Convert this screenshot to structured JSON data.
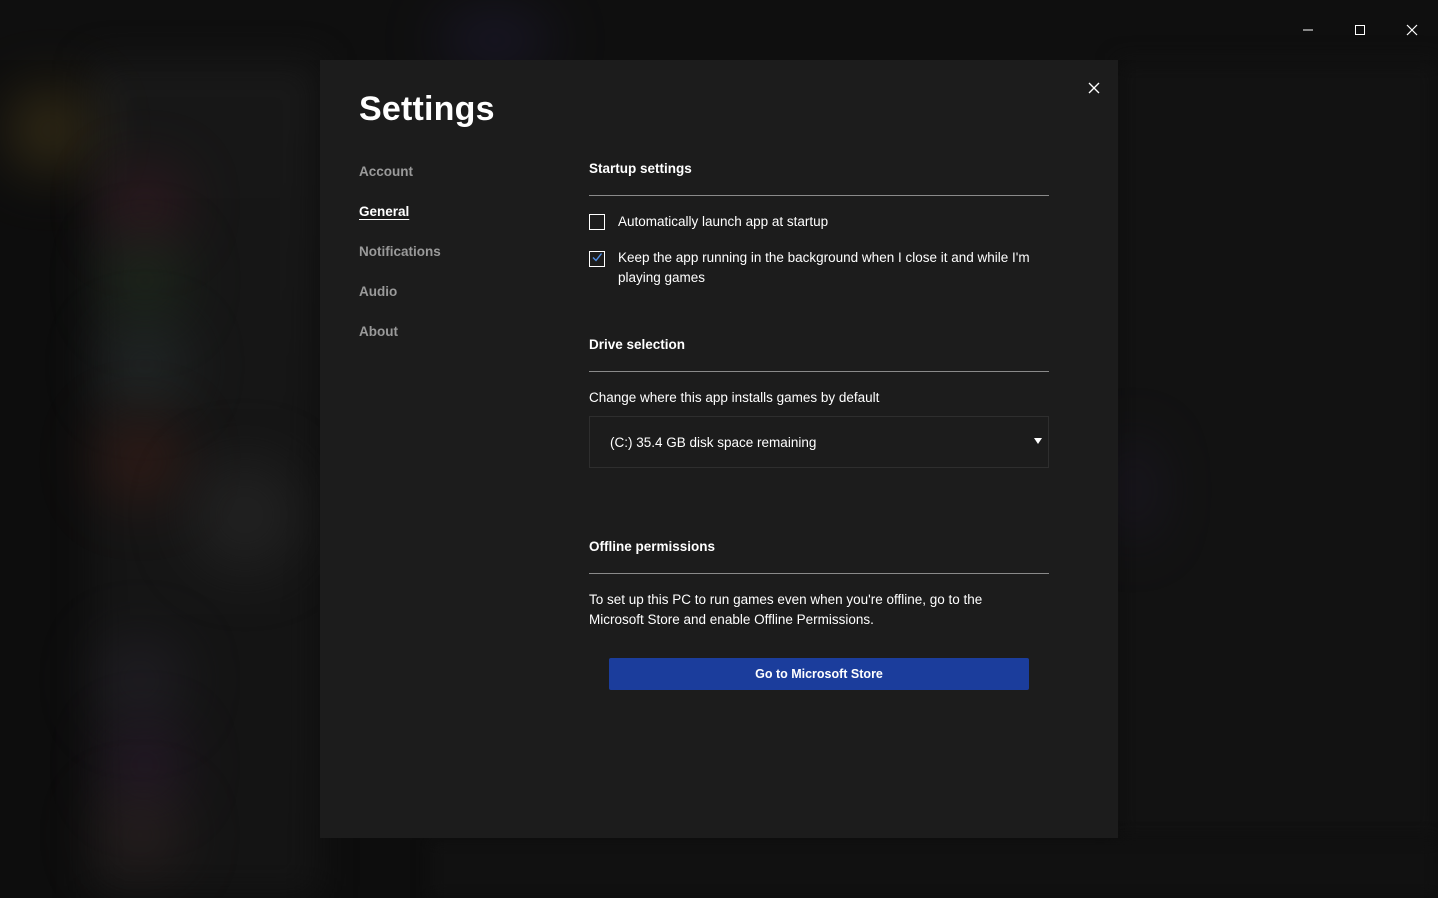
{
  "window": {
    "controls": {
      "minimize_icon": "minimize-icon",
      "maximize_icon": "maximize-icon",
      "close_icon": "close-icon"
    }
  },
  "dialog": {
    "title": "Settings",
    "close_icon": "close-icon"
  },
  "nav": {
    "items": [
      {
        "label": "Account",
        "active": false
      },
      {
        "label": "General",
        "active": true
      },
      {
        "label": "Notifications",
        "active": false
      },
      {
        "label": "Audio",
        "active": false
      },
      {
        "label": "About",
        "active": false
      }
    ]
  },
  "startup": {
    "title": "Startup settings",
    "options": [
      {
        "label": "Automatically launch app at startup",
        "checked": false
      },
      {
        "label": "Keep the app running in the background when I close it and while I'm playing games",
        "checked": true
      }
    ]
  },
  "drive": {
    "title": "Drive selection",
    "description": "Change where this app installs games by default",
    "selected": "(C:) 35.4 GB disk space remaining",
    "arrow_icon": "dropdown-arrow-icon"
  },
  "offline": {
    "title": "Offline permissions",
    "description": "To set up this PC to run games even when you're offline, go to the Microsoft Store and enable Offline Permissions.",
    "button_label": "Go to Microsoft Store"
  },
  "colors": {
    "dialog_bg": "#1c1c1c",
    "accent_button": "#1b3d9c",
    "checkbox_accent": "#4f8fe8",
    "nav_inactive": "#9a9a9a"
  }
}
